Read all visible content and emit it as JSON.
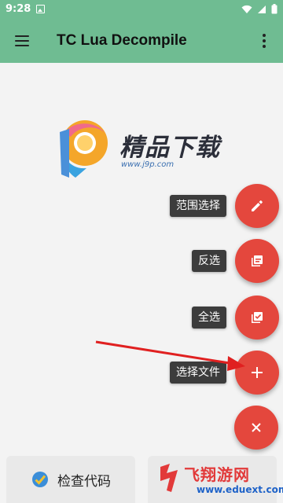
{
  "status_bar": {
    "time": "9:28"
  },
  "app_bar": {
    "title": "TC Lua Decompile"
  },
  "watermark": {
    "title": "精品下载",
    "url": "www.j9p.com"
  },
  "fab_menu": [
    {
      "label": "范围选择",
      "icon": "edit-pencil-icon"
    },
    {
      "label": "反选",
      "icon": "invert-select-icon"
    },
    {
      "label": "全选",
      "icon": "select-all-icon"
    },
    {
      "label": "选择文件",
      "icon": "add-plus-icon"
    }
  ],
  "fab_close": {
    "icon": "close-x-icon"
  },
  "bottom": {
    "check_code_label": "检查代码"
  },
  "corner_watermark": {
    "text": "飞翔游网",
    "url": "www.eduext.com"
  },
  "colors": {
    "appbar": "#6fbc92",
    "fab": "#e4473d",
    "label_bg": "#3c3c3c",
    "arrow": "#e02020"
  }
}
